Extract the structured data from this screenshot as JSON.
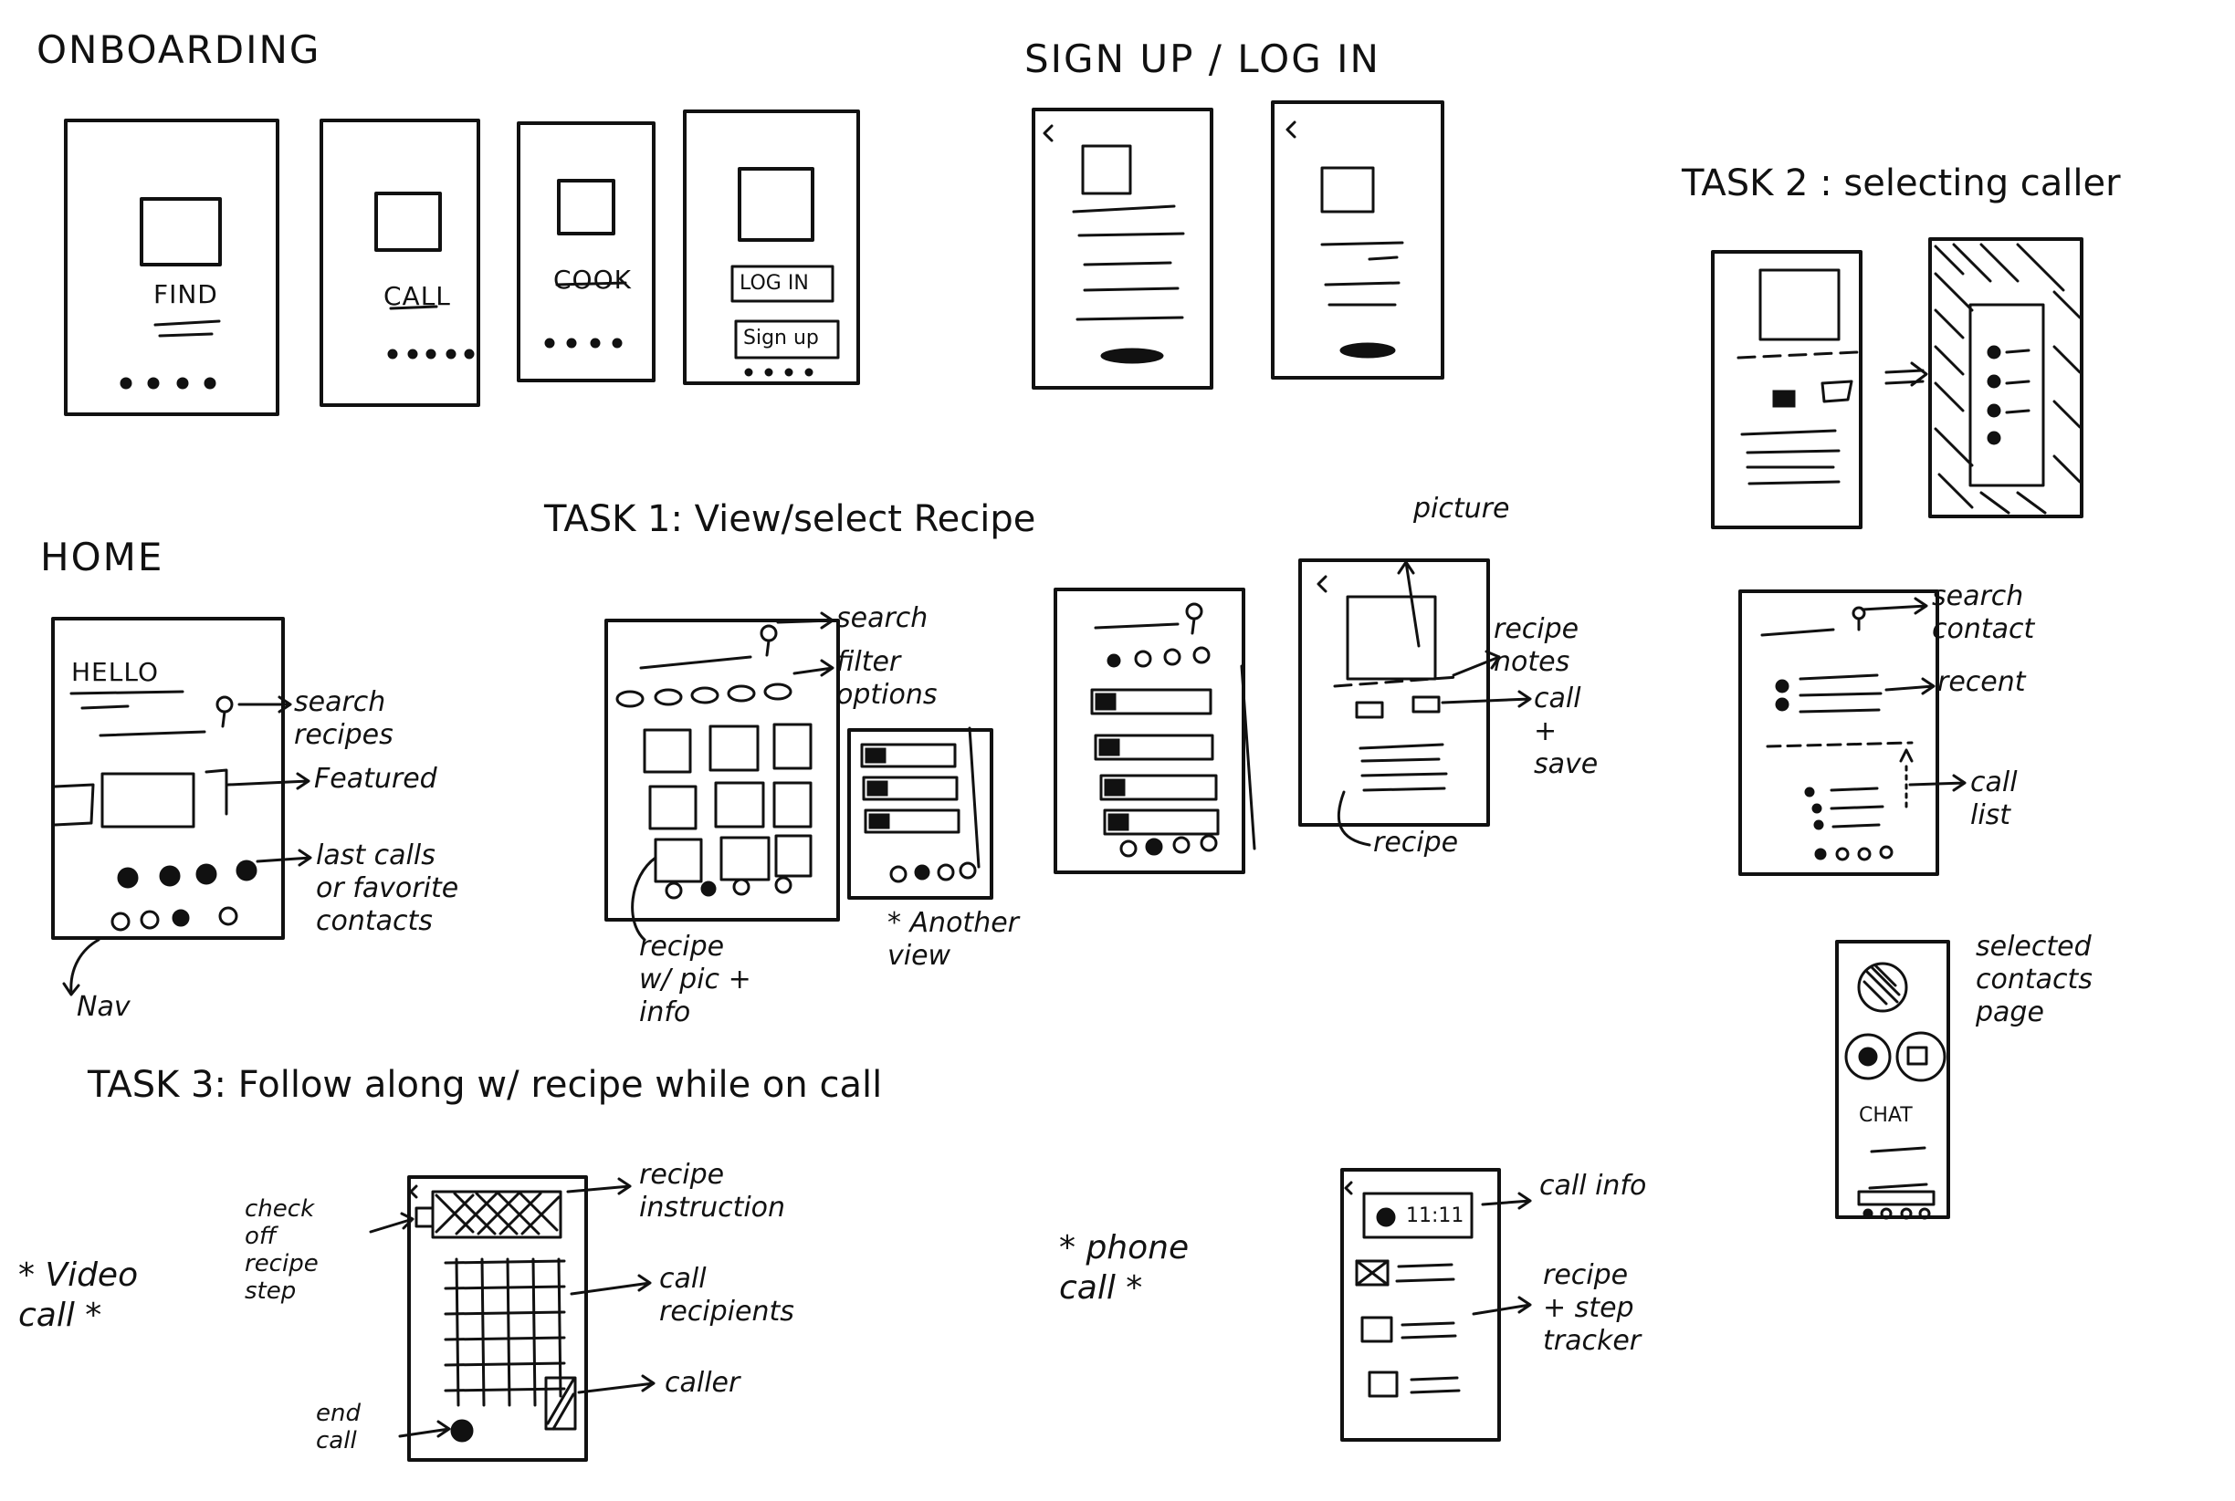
{
  "sections": {
    "onboarding": "ONBOARDING",
    "signup": "SIGN UP / LOG IN",
    "task2": "TASK 2 : selecting caller",
    "home": "HOME",
    "task1": "TASK 1: View/select Recipe",
    "task3": "TASK 3: Follow along w/ recipe while on call"
  },
  "onboarding_labels": {
    "find": "FIND",
    "call": "CALL",
    "cook": "COOK",
    "login": "LOG IN",
    "signup": "Sign up"
  },
  "home": {
    "hello": "HELLO",
    "search": "search\nrecipes",
    "featured": "Featured",
    "last_calls": "last calls\nor favorite\ncontacts",
    "nav": "Nav"
  },
  "task1": {
    "search": "search",
    "filter": "filter\noptions",
    "recipe_pic": "recipe\nw/ pic +\ninfo",
    "another_view": "* Another\nview",
    "picture": "picture",
    "recipe_notes": "recipe\nnotes",
    "call_save": "call\n+\nsave",
    "recipe": "recipe"
  },
  "task2": {
    "search_contact": "search\ncontact",
    "recent": "recent",
    "call_list": "call\nlist",
    "selected_contacts": "selected\ncontacts\npage",
    "chat": "CHAT"
  },
  "task3": {
    "video_call": "* Video\ncall *",
    "check_off": "check\noff\nrecipe\nstep",
    "recipe_instruction": "recipe\ninstruction",
    "call_recipients": "call\nrecipients",
    "caller": "caller",
    "end_call": "end\ncall",
    "phone_call": "* phone\ncall *",
    "call_info": "call info",
    "timer": "11:11",
    "recipe_step_tracker": "recipe\n+ step\ntracker"
  }
}
